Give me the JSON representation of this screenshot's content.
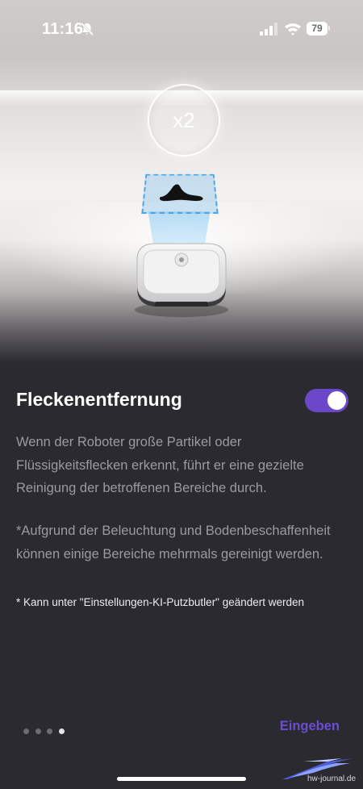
{
  "status_bar": {
    "time": "11:16",
    "battery_level": "79"
  },
  "illustration": {
    "repeat_badge": "x2"
  },
  "feature": {
    "title": "Fleckenentfernung",
    "toggle_on": true,
    "description": "Wenn der Roboter große Partikel oder Flüssigkeitsflecken erkennt, führt er eine gezielte Reinigung der betroffenen Bereiche durch.",
    "note": "*Aufgrund der Beleuchtung und Bodenbeschaffenheit können einige Bereiche mehrmals gereinigt werden.",
    "footnote": "* Kann unter \"Einstellungen-KI-Putzbutler\" geändert werden"
  },
  "pagination": {
    "total": 4,
    "current": 4
  },
  "actions": {
    "enter_label": "Eingeben"
  },
  "watermark": {
    "text": "hw-journal.de"
  },
  "colors": {
    "accent": "#6a48c7",
    "background": "#2b2a30",
    "detection_zone": "#4aa6e8"
  }
}
